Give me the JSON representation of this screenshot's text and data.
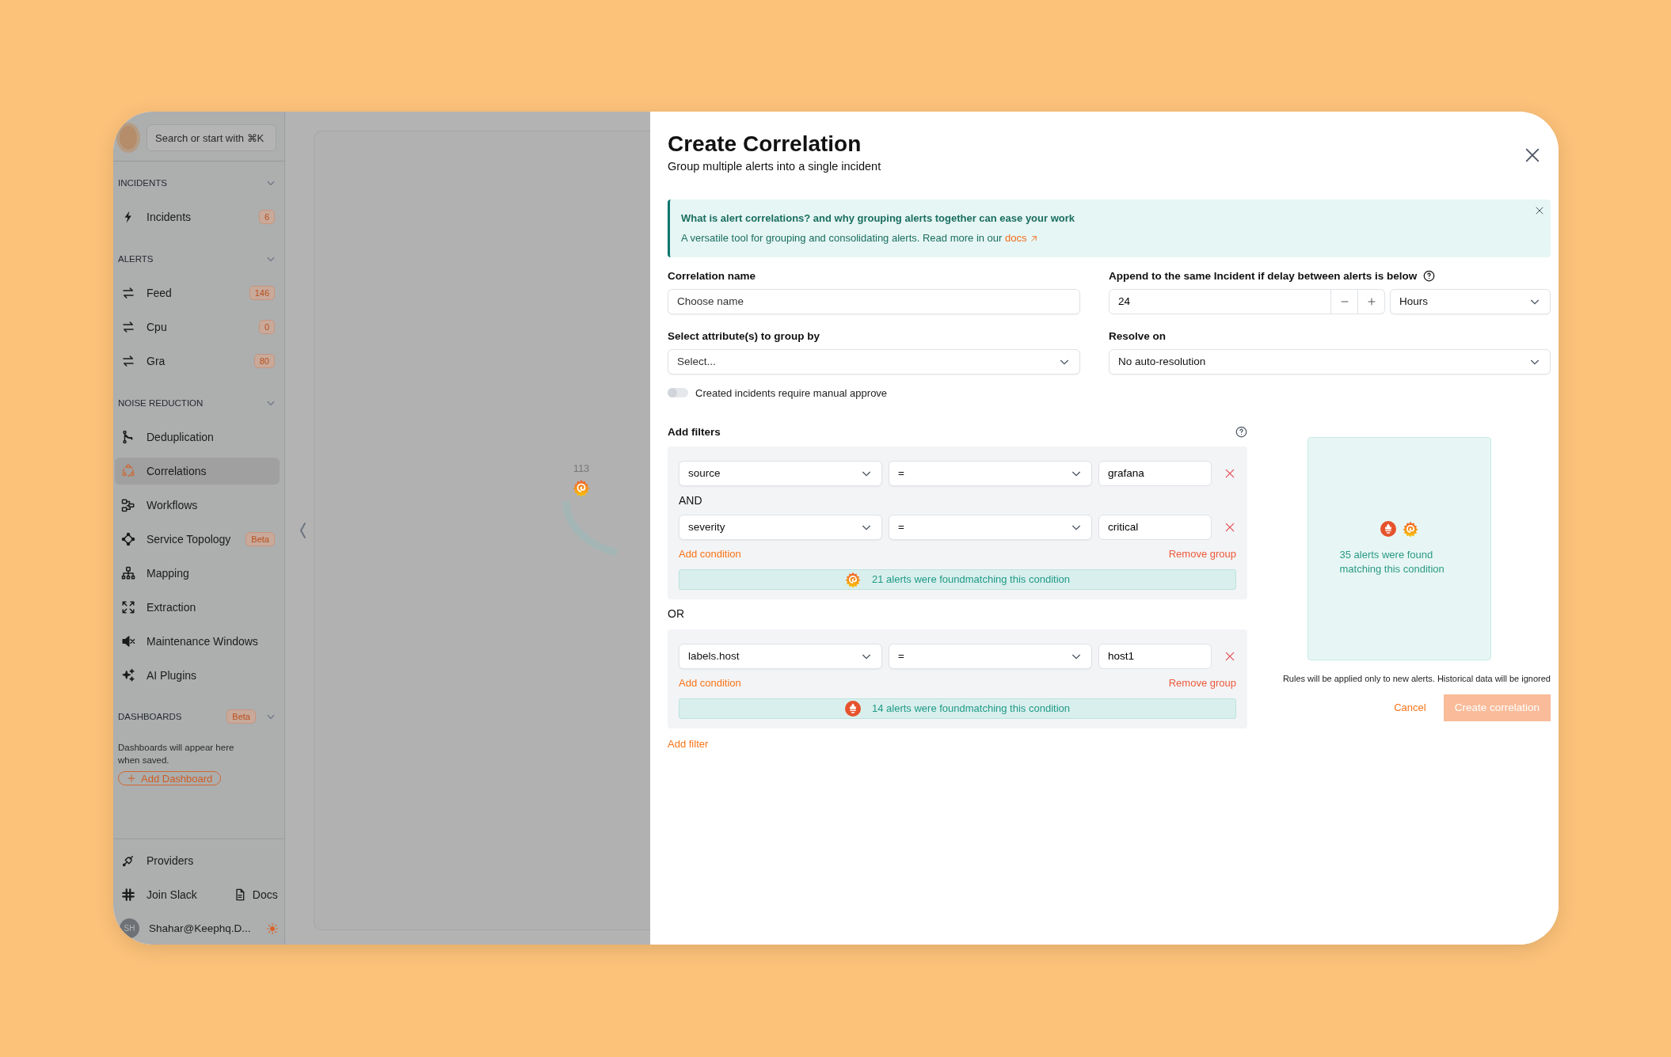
{
  "sidebar": {
    "search": {
      "placeholder": "Search or start with ⌘K"
    },
    "sections": [
      {
        "title": "INCIDENTS",
        "expanded": true,
        "items": [
          {
            "kind": "bolt",
            "label": "Incidents",
            "count": "6",
            "selected": false
          }
        ]
      },
      {
        "title": "ALERTS",
        "expanded": true,
        "items": [
          {
            "kind": "swap",
            "label": "Feed",
            "count": "146",
            "selected": false
          },
          {
            "kind": "swap",
            "label": "Cpu",
            "count": "0",
            "selected": false
          },
          {
            "kind": "swap",
            "label": "Gra",
            "count": "80",
            "selected": false
          }
        ]
      },
      {
        "title": "NOISE REDUCTION",
        "expanded": true,
        "items": [
          {
            "kind": "dedup",
            "label": "Deduplication",
            "selected": false
          },
          {
            "kind": "correlation",
            "label": "Correlations",
            "selected": true
          },
          {
            "kind": "workflow",
            "label": "Workflows",
            "selected": false
          },
          {
            "kind": "topology",
            "label": "Service Topology",
            "badge": "Beta",
            "selected": false
          },
          {
            "kind": "mapping",
            "label": "Mapping",
            "selected": false
          },
          {
            "kind": "extraction",
            "label": "Extraction",
            "selected": false
          },
          {
            "kind": "mute",
            "label": "Maintenance Windows",
            "selected": false
          },
          {
            "kind": "sparkles",
            "label": "AI Plugins",
            "selected": false
          }
        ]
      }
    ],
    "dashboards": {
      "title": "DASHBOARDS",
      "badge": "Beta",
      "expanded": true,
      "empty_text": "Dashboards will appear here when saved.",
      "add_button": "Add Dashboard"
    },
    "footer": {
      "providers": "Providers",
      "slack": "Join Slack",
      "docs": "Docs",
      "user": {
        "initials": "SH",
        "name": "Shahar@Keephq.D..."
      }
    }
  },
  "canvas": {
    "node": {
      "count": "113"
    }
  },
  "modal": {
    "title": "Create Correlation",
    "subtitle": "Group multiple alerts into a single incident",
    "banner": {
      "title": "What is alert correlations? and why grouping alerts together can ease your work",
      "text": "A versatile tool for grouping and consolidating alerts. Read more in our",
      "link": "docs"
    },
    "fields": {
      "name": {
        "label": "Correlation name",
        "placeholder": "Choose name"
      },
      "delay": {
        "label": "Append to the same Incident if delay between alerts is below",
        "value": "24",
        "unit": "Hours"
      },
      "group_by": {
        "label": "Select attribute(s) to group by",
        "placeholder": "Select..."
      },
      "resolve_on": {
        "label": "Resolve on",
        "value": "No auto-resolution"
      },
      "manual_approve": {
        "label": "Created incidents require manual approve",
        "on": false
      }
    },
    "filters": {
      "title": "Add filters",
      "group_joiner": "OR",
      "add_filter": "Add filter",
      "groups": [
        {
          "conditions": [
            {
              "field": "source",
              "operator": "=",
              "value": "grafana"
            },
            {
              "joiner": "AND",
              "field": "severity",
              "operator": "=",
              "value": "critical"
            }
          ],
          "add_condition": "Add condition",
          "remove_group": "Remove group",
          "match": {
            "kind": "grafana",
            "text": "21 alerts were foundmatching this condition"
          }
        },
        {
          "conditions": [
            {
              "field": "labels.host",
              "operator": "=",
              "value": "host1"
            }
          ],
          "add_condition": "Add condition",
          "remove_group": "Remove group",
          "match": {
            "kind": "prometheus",
            "text": "14 alerts were foundmatching this condition"
          }
        }
      ]
    },
    "preview": {
      "sources": [
        {
          "kind": "prometheus"
        },
        {
          "kind": "grafana"
        }
      ],
      "text": "35 alerts were found matching this condition"
    },
    "note": "Rules will be applied only to new alerts. Historical data will be ignored",
    "cancel": "Cancel",
    "submit": {
      "label": "Create correlation",
      "disabled": true
    }
  }
}
